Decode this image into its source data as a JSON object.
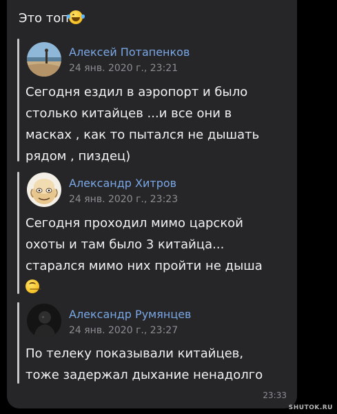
{
  "message": {
    "text": "Это топ",
    "emoji": "laughing-crying-emoji",
    "time": "23:33"
  },
  "quotes": [
    {
      "author": "Алексей Потапенков",
      "date": "24 янв. 2020 г., 23:21",
      "text": "Сегодня ездил в аэропорт и было\nстолько китайцев ...и все они в\nмасках , как то пытался не дышать\nрядом , пиздец)"
    },
    {
      "author": "Александр Хитров",
      "date": "24 янв. 2020 г., 23:23",
      "text": "Сегодня проходил мимо царской\nохоты и там было 3 китайца...\nстарался мимо них пройти не дыша",
      "emoji": "upside-down-face-emoji"
    },
    {
      "author": "Александр Румянцев",
      "date": "24 янв. 2020 г., 23:27",
      "text": "По телеку показывали китайцев,\nтоже задержал дыхание ненадолго"
    }
  ],
  "watermark": "SHUTOK.RU",
  "colors": {
    "background": "#000000",
    "bubble": "#262628",
    "author_name": "#7aa7e5",
    "text": "#f2f2f2",
    "secondary_text": "#8e8e93",
    "quote_bar": "#c7c7cc"
  }
}
